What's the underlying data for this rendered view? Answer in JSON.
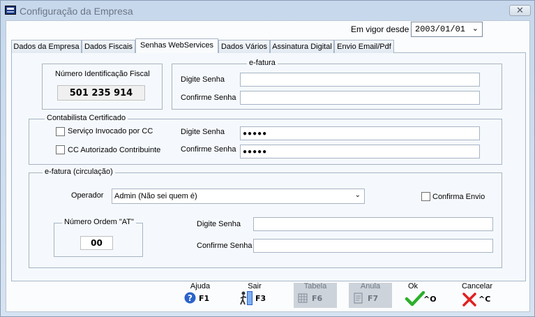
{
  "window": {
    "title": "Configuração da Empresa",
    "close_glyph": "✕",
    "icon": "app-icon"
  },
  "effective_date": {
    "label": "Em vigor desde :",
    "value": "2003/01/01"
  },
  "tabs": [
    {
      "label": "Dados da Empresa"
    },
    {
      "label": "Dados Fiscais"
    },
    {
      "label": "Senhas WebServices"
    },
    {
      "label": "Dados Vários"
    },
    {
      "label": "Assinatura Digital"
    },
    {
      "label": "Envio Email/Pdf"
    }
  ],
  "active_tab": "Senhas WebServices",
  "nif": {
    "label": "Número Identificação Fiscal",
    "value": "501 235 914"
  },
  "efatura": {
    "legend": "e-fatura",
    "password_label": "Digite Senha",
    "password_value": "",
    "confirm_label": "Confirme Senha",
    "confirm_value": ""
  },
  "accountant": {
    "legend": "Contabilista Certificado",
    "checkbox_invoked": {
      "label": "Serviço Invocado por CC",
      "checked": false
    },
    "checkbox_authorized": {
      "label": "CC Autorizado Contribuinte",
      "checked": false
    },
    "password_label": "Digite Senha",
    "password_value": "●●●●●",
    "confirm_label": "Confirme Senha",
    "confirm_value": "●●●●●"
  },
  "circulation": {
    "legend": "e-fatura (circulação)",
    "operator_label": "Operador",
    "operator_value": "Admin (Não sei quem é)",
    "confirm_send_label": "Confirma Envio",
    "confirm_send_checked": false,
    "order_legend": "Número Ordem \"AT\"",
    "order_value": "00",
    "password_label": "Digite Senha",
    "password_value": "",
    "confirm_label": "Confirme Senha",
    "confirm_value": ""
  },
  "footer_buttons": [
    {
      "caption": "Ajuda",
      "key": "F1",
      "icon": "help-icon",
      "enabled": true
    },
    {
      "caption": "Sair",
      "key": "F3",
      "icon": "exit-icon",
      "enabled": true
    },
    {
      "caption": "Tabela",
      "key": "F6",
      "icon": "table-icon",
      "enabled": false
    },
    {
      "caption": "Anula",
      "key": "F7",
      "icon": "cancel-record-icon",
      "enabled": false
    },
    {
      "caption": "Ok",
      "key": "^O",
      "icon": "checkmark-icon",
      "enabled": true
    },
    {
      "caption": "Cancelar",
      "key": "^C",
      "icon": "x-icon",
      "enabled": true
    }
  ],
  "colors": {
    "title_text": "#6b7686",
    "ok_green": "#2bb02b",
    "cancel_red": "#e02020",
    "help_blue": "#2a62c9"
  }
}
